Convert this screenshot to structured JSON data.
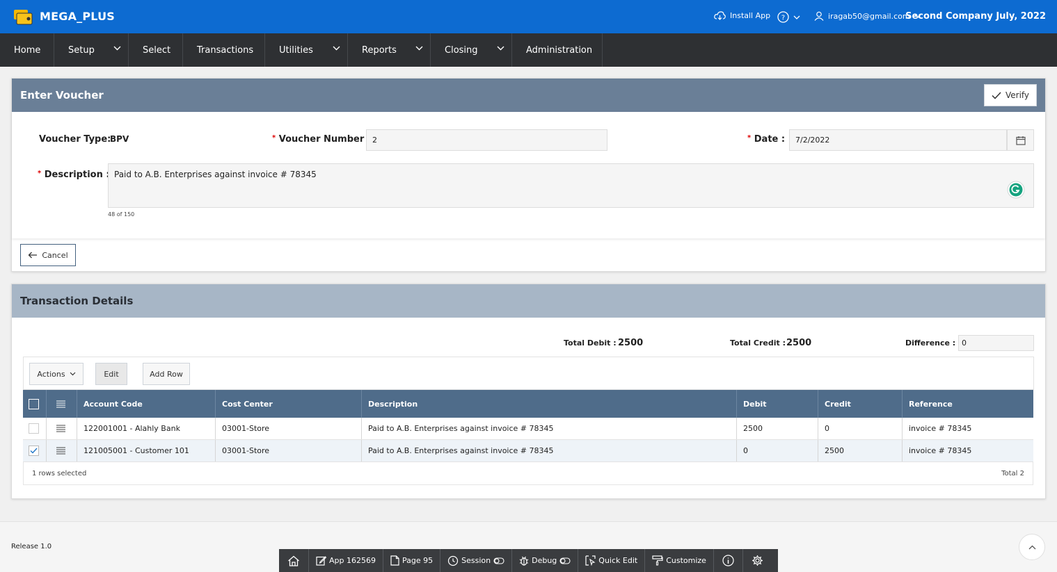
{
  "app": {
    "name": "MEGA_PLUS",
    "install_label": "Install App",
    "user_email": "iragab50@gmail.com",
    "company": "Second Company July, 2022"
  },
  "nav": {
    "items": [
      {
        "label": "Home"
      },
      {
        "label": "Setup"
      },
      {
        "label": "Select"
      },
      {
        "label": "Transactions"
      },
      {
        "label": "Utilities"
      },
      {
        "label": "Reports"
      },
      {
        "label": "Closing"
      },
      {
        "label": "Administration"
      }
    ]
  },
  "voucher": {
    "title": "Enter Voucher",
    "verify_label": "Verify",
    "type_label": "Voucher Type:",
    "type_value": "BPV",
    "number_label": "Voucher Number :",
    "number_value": "2",
    "date_label": "Date :",
    "date_value": "7/2/2022",
    "description_label": "Description :",
    "description_value": "Paid to A.B. Enterprises against invoice # 78345",
    "char_count": "48 of 150",
    "cancel_label": "Cancel"
  },
  "details": {
    "title": "Transaction Details",
    "total_debit_label": "Total Debit :",
    "total_debit": "2500",
    "total_credit_label": "Total Credit :",
    "total_credit": "2500",
    "difference_label": "Difference :",
    "difference": "0",
    "actions_label": "Actions",
    "edit_label": "Edit",
    "add_row_label": "Add Row",
    "columns": [
      "Account Code",
      "Cost Center",
      "Description",
      "Debit",
      "Credit",
      "Reference"
    ],
    "rows": [
      {
        "selected": false,
        "cells": [
          "122001001 - Alahly Bank",
          "03001-Store",
          "Paid to A.B. Enterprises against invoice # 78345",
          "2500",
          "0",
          "invoice # 78345"
        ]
      },
      {
        "selected": true,
        "cells": [
          "121005001 - Customer 101",
          "03001-Store",
          "Paid to A.B. Enterprises against invoice # 78345",
          "0",
          "2500",
          "invoice # 78345"
        ]
      }
    ],
    "selection_status": "1 rows selected",
    "total_status": "Total 2"
  },
  "footer": {
    "release": "Release 1.0"
  },
  "devbar": {
    "app": "App 162569",
    "page": "Page 95",
    "session": "Session",
    "debug": "Debug",
    "quick_edit": "Quick Edit",
    "customize": "Customize"
  },
  "colors": {
    "topbar": "#0d6bd1",
    "nav": "#2e3033",
    "region_header": "#6a7f97",
    "grid_header": "#4f6c8a"
  }
}
